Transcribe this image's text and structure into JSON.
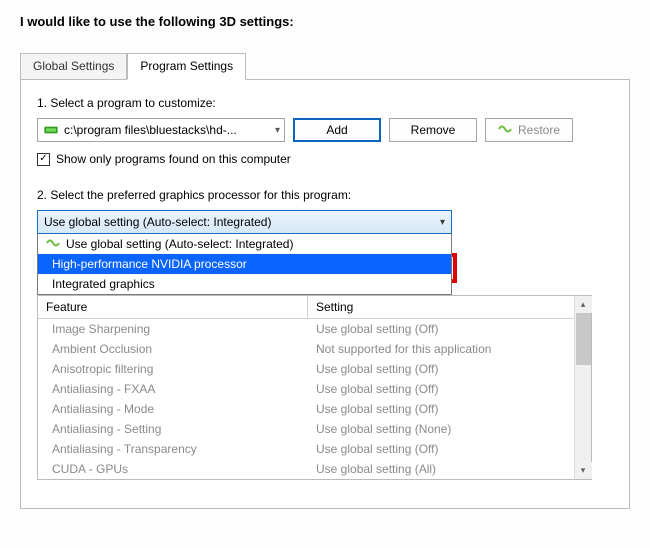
{
  "title": "I would like to use the following 3D settings:",
  "tabs": {
    "global": "Global Settings",
    "program": "Program Settings"
  },
  "step1": {
    "label": "1. Select a program to customize:",
    "selected_program": "c:\\program files\\bluestacks\\hd-...",
    "add": "Add",
    "remove": "Remove",
    "restore": "Restore",
    "show_only_label": "Show only programs found on this computer",
    "show_only_checked": "✓"
  },
  "step2": {
    "label": "2. Select the preferred graphics processor for this program:",
    "selected": "Use global setting (Auto-select: Integrated)",
    "options": [
      "Use global setting (Auto-select: Integrated)",
      "High-performance NVIDIA processor",
      "Integrated graphics"
    ]
  },
  "feature_table": {
    "header_feature": "Feature",
    "header_setting": "Setting",
    "rows": [
      {
        "feature": "Image Sharpening",
        "setting": "Use global setting (Off)"
      },
      {
        "feature": "Ambient Occlusion",
        "setting": "Not supported for this application"
      },
      {
        "feature": "Anisotropic filtering",
        "setting": "Use global setting (Off)"
      },
      {
        "feature": "Antialiasing - FXAA",
        "setting": "Use global setting (Off)"
      },
      {
        "feature": "Antialiasing - Mode",
        "setting": "Use global setting (Off)"
      },
      {
        "feature": "Antialiasing - Setting",
        "setting": "Use global setting (None)"
      },
      {
        "feature": "Antialiasing - Transparency",
        "setting": "Use global setting (Off)"
      },
      {
        "feature": "CUDA - GPUs",
        "setting": "Use global setting (All)"
      }
    ]
  }
}
